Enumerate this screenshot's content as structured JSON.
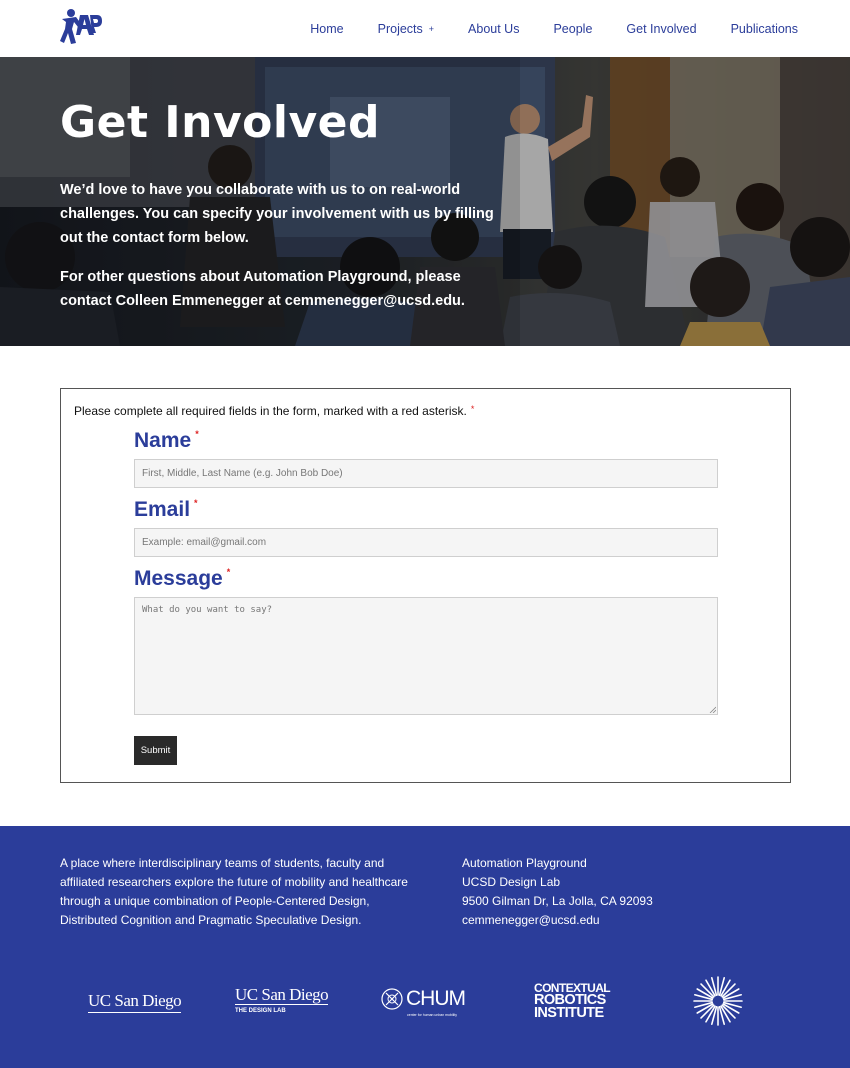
{
  "nav": {
    "logo_alt": "Automation Playground logo",
    "items": [
      {
        "label": "Home"
      },
      {
        "label": "Projects",
        "has_submenu": true,
        "submenu_icon": "+"
      },
      {
        "label": "About Us"
      },
      {
        "label": "People"
      },
      {
        "label": "Get Involved"
      },
      {
        "label": "Publications"
      }
    ]
  },
  "hero": {
    "title": "Get Involved",
    "paragraph1": "We’d love to have you collaborate with us to on real-world challenges. You can specify your involvement with us by filling out the contact form below.",
    "paragraph2": "For other questions about Automation Playground, please contact Colleen Emmenegger at cemmenegger@ucsd.edu."
  },
  "form": {
    "note": "Please complete all required fields in the form, marked with a red asterisk.",
    "required_marker": "*",
    "fields": {
      "name": {
        "label": "Name",
        "placeholder": "First, Middle, Last Name (e.g. John Bob Doe)"
      },
      "email": {
        "label": "Email",
        "placeholder": "Example: email@gmail.com"
      },
      "message": {
        "label": "Message",
        "placeholder": "What do you want to say?"
      }
    },
    "submit_label": "Submit"
  },
  "footer": {
    "about": "A place where interdisciplinary teams of students, faculty and affiliated researchers explore the future of mobility and healthcare through a unique combination of People-Centered Design, Distributed Cognition and Pragmatic Speculative Design.",
    "address_lines": [
      "Automation Playground",
      "UCSD Design Lab",
      "9500 Gilman Dr, La Jolla, CA 92093",
      "cemmenegger@ucsd.edu"
    ],
    "logos": {
      "ucsd": "UC San Diego",
      "ucsd_design_lab_name": "UC San Diego",
      "ucsd_design_lab_sub": "THE DESIGN LAB",
      "chum": "CHUM",
      "chum_sub": "center for human unban mobility",
      "cri_line1": "CONTEXTUAL",
      "cri_line2": "ROBOTICS",
      "cri_line3": "INSTITUTE"
    }
  },
  "colors": {
    "brand_blue": "#2b3d9a",
    "required_red": "#dd2222",
    "submit_bg": "#2a2a2a"
  }
}
